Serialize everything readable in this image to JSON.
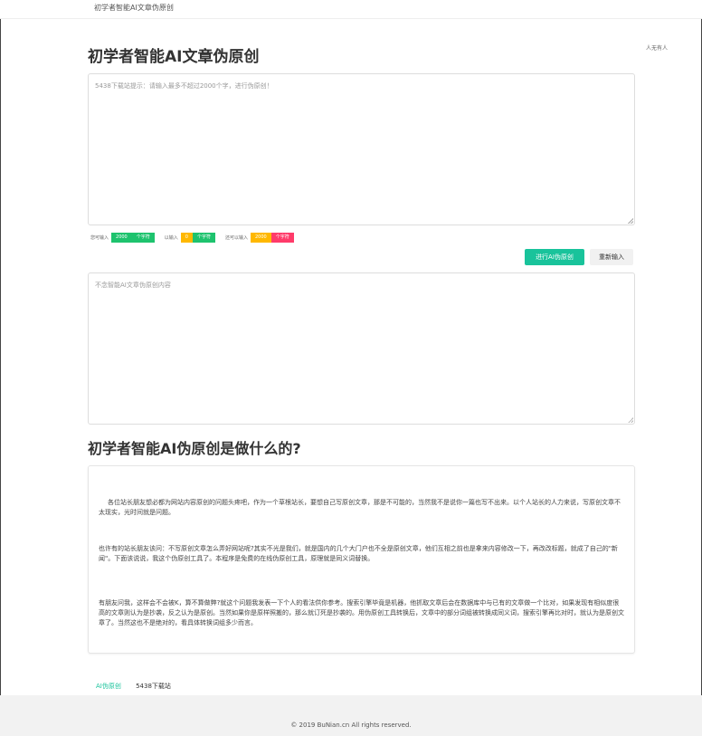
{
  "topbar": {
    "brand": "初学者智能AI文章伪原创"
  },
  "header": {
    "title": "初学者智能AI文章伪原创",
    "login": "人无有人"
  },
  "input_box": {
    "placeholder": "5438下载站提示：请输入最多不超过2000个字，进行伪原创！"
  },
  "counters": {
    "can_input_label": "您可输入",
    "can_input_value": "2000",
    "unit1": "个字符",
    "entered_label": "以输入",
    "entered_value": "0",
    "unit2": "个字符",
    "remaining_label": "还可以输入",
    "remaining_value": "2000",
    "unit3": "个字符"
  },
  "buttons": {
    "run": "进行AI伪原创",
    "reset": "重新输入"
  },
  "output_box": {
    "placeholder": "不念智能AI文章伪原创内容"
  },
  "section": {
    "title": "初学者智能AI伪原创是做什么的?",
    "p1": "各位站长朋友想必都为网站内容原创的问题头疼吧，作为一个草根站长，要想自己写原创文章，那是不可能的，当然我不是说你一篇也写不出来。以个人站长的人力来说，写原创文章不太现实，光时间就是问题。",
    "p2": "也许有的站长朋友该问：不写原创文章怎么弄好网站呢?其实不光是我们，就是国内的几个大门户也不全是原创文章，他们互相之前也是拿来内容修改一下，再改改标题，就成了自己的\"新闻\"。下面该说说，我这个伪原创工具了。本程序是免费的在线伪原创工具，原理就是同义词替换。",
    "p3": "有朋友问我，这样会不会被K，算不算做弊?就这个问题我发表一下个人的看法供你参考。搜索引擎毕竟是机器，他抓取文章后会在数据库中与已有的文章做一个比对，如果发现有相似度很高的文章则认为是抄袭，反之认为是原创。当然如果你是原样照搬的，那么就订死是抄袭的。用伪原创工具转换后，文章中的部分词组被转换成同义词，搜索引擎再比对时，就认为是原创文章了。当然这也不是绝对的，看具体转换词组多少而言。"
  },
  "footer_links": {
    "link1": "AI伪原创",
    "link2": "5438下载站"
  },
  "footer": {
    "copyright": "© 2019 BuNian.cn All rights reserved."
  },
  "colors": {
    "accent": "#19c39b",
    "green": "#1ec36e",
    "yellow": "#ffb800",
    "red": "#ff3b6a"
  }
}
